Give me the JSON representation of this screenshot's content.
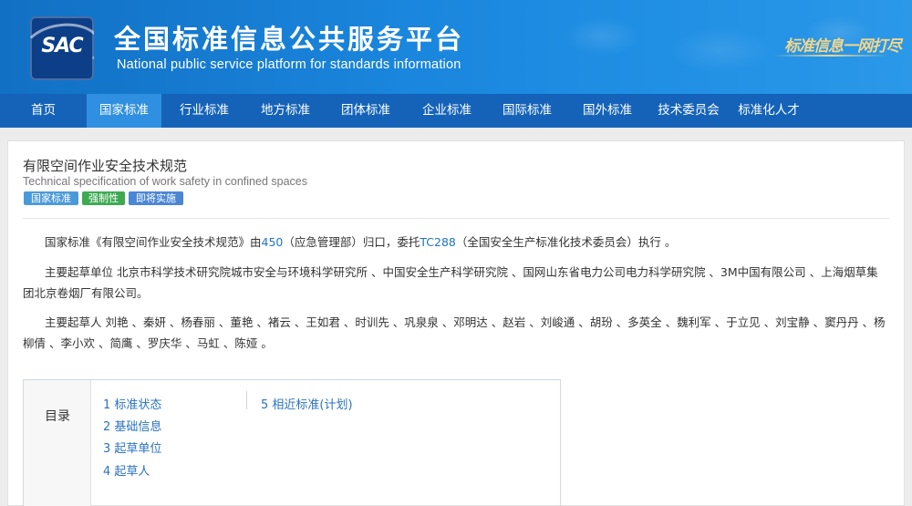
{
  "header": {
    "logo_text": "SAC",
    "title": "全国标准信息公共服务平台",
    "subtitle": "National public service platform  for standards information",
    "slogan": "标准信息一网打尽"
  },
  "nav": {
    "items": [
      {
        "label": "首页"
      },
      {
        "label": "国家标准"
      },
      {
        "label": "行业标准"
      },
      {
        "label": "地方标准"
      },
      {
        "label": "团体标准"
      },
      {
        "label": "企业标准"
      },
      {
        "label": "国际标准"
      },
      {
        "label": "国外标准"
      },
      {
        "label": "技术委员会"
      },
      {
        "label": "标准化人才"
      }
    ],
    "active_index": 1
  },
  "standard": {
    "title": "有限空间作业安全技术规范",
    "title_en": "Technical specification of work safety in confined spaces",
    "badges": [
      {
        "label": "国家标准",
        "color": "#4a9ad9"
      },
      {
        "label": "强制性",
        "color": "#3daa52"
      },
      {
        "label": "即将实施",
        "color": "#4a86d4"
      }
    ]
  },
  "intro": {
    "prefix": "国家标准《有限空间作业安全技术规范》由",
    "dept_code": "450",
    "dept_name": "（应急管理部）归口，委托",
    "tc_code": "TC288",
    "tc_name": "（全国安全生产标准化技术委员会）执行 。"
  },
  "drafting_units": {
    "label": "主要起草单位",
    "text": " 北京市科学技术研究院城市安全与环境科学研究所 、中国安全生产科学研究院 、国网山东省电力公司电力科学研究院 、3M中国有限公司 、上海烟草集团北京卷烟厂有限公司。"
  },
  "drafters": {
    "label": "主要起草人",
    "text": " 刘艳 、秦妍 、杨春丽 、董艳 、褚云 、王如君 、时训先 、巩泉泉 、邓明达 、赵岩 、刘峻通 、胡玢 、多英全 、魏利军 、于立见 、刘宝静 、窦丹丹 、杨柳倩 、李小欢 、简鹰 、罗庆华 、马虹 、陈娅 。"
  },
  "toc": {
    "label": "目录",
    "items": [
      "1  标准状态",
      "2  基础信息",
      "3  起草单位",
      "4  起草人",
      "5  相近标准(计划)"
    ]
  }
}
